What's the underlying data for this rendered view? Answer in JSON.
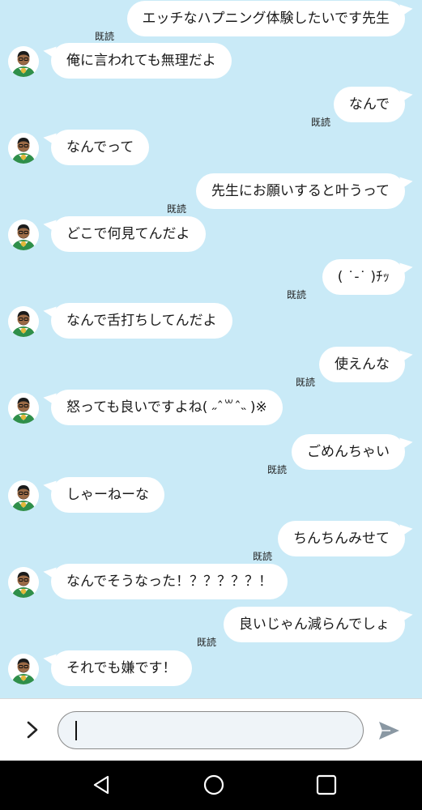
{
  "read_label": "既読",
  "messages": [
    {
      "dir": "sent",
      "text": "エッチなハプニング体験したいです先生"
    },
    {
      "dir": "recv",
      "text": "俺に言われても無理だよ"
    },
    {
      "dir": "sent",
      "text": "なんで"
    },
    {
      "dir": "recv",
      "text": "なんでって"
    },
    {
      "dir": "sent",
      "text": "先生にお願いすると叶うって"
    },
    {
      "dir": "recv",
      "text": "どこで何見てんだよ"
    },
    {
      "dir": "sent",
      "text": "( ˙-˙ )ﾁｯ"
    },
    {
      "dir": "recv",
      "text": "なんで舌打ちしてんだよ"
    },
    {
      "dir": "sent",
      "text": "使えんな"
    },
    {
      "dir": "recv",
      "text": "怒っても良いですよね( ˶ˆ꒳ˆ˵ )※"
    },
    {
      "dir": "sent",
      "text": "ごめんちゃい"
    },
    {
      "dir": "recv",
      "text": "しゃーねーな"
    },
    {
      "dir": "sent",
      "text": "ちんちんみせて"
    },
    {
      "dir": "recv",
      "text": "なんでそうなった！？？？？？！"
    },
    {
      "dir": "sent",
      "text": "良いじゃん減らんでしょ"
    },
    {
      "dir": "recv",
      "text": "それでも嫌です！"
    }
  ],
  "composer": {
    "expand_icon": "chevron-right-icon",
    "input_value": "",
    "send_icon": "send-icon"
  },
  "navbar": {
    "back_icon": "back-triangle-icon",
    "home_icon": "home-circle-icon",
    "recents_icon": "recents-square-icon"
  }
}
